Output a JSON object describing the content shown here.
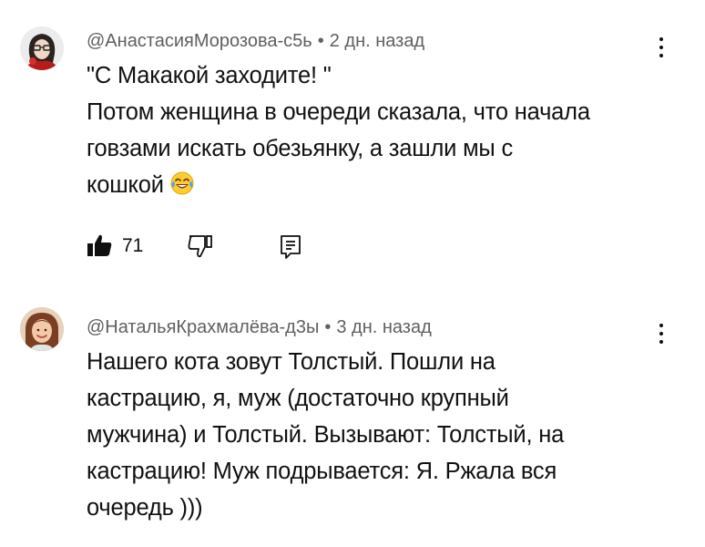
{
  "comments": [
    {
      "author": "@АнастасияМорозова-с5ь",
      "time": "2 дн. назад",
      "lines": [
        "\"С Макакой заходите! \"",
        "Потом женщина в очереди сказала, что начала",
        "говзами искать обезьянку, а зашли мы с",
        "кошкой"
      ],
      "emoji": "face-with-tears-of-joy",
      "likes": "71"
    },
    {
      "author": "@НатальяКрахмалёва-д3ы",
      "time": "3 дн. назад",
      "lines": [
        "Нашего кота зовут Толстый. Пошли на",
        "кастрацию, я, муж (достаточно крупный",
        "мужчина) и Толстый. Вызывают: Толстый, на",
        "кастрацию! Муж подрывается: Я. Ржала вся",
        "очередь )))"
      ]
    }
  ],
  "separator": "•",
  "icons": {
    "like": "thumbs-up-icon",
    "dislike": "thumbs-down-icon",
    "reply": "reply-icon",
    "more": "more-vertical-icon"
  }
}
